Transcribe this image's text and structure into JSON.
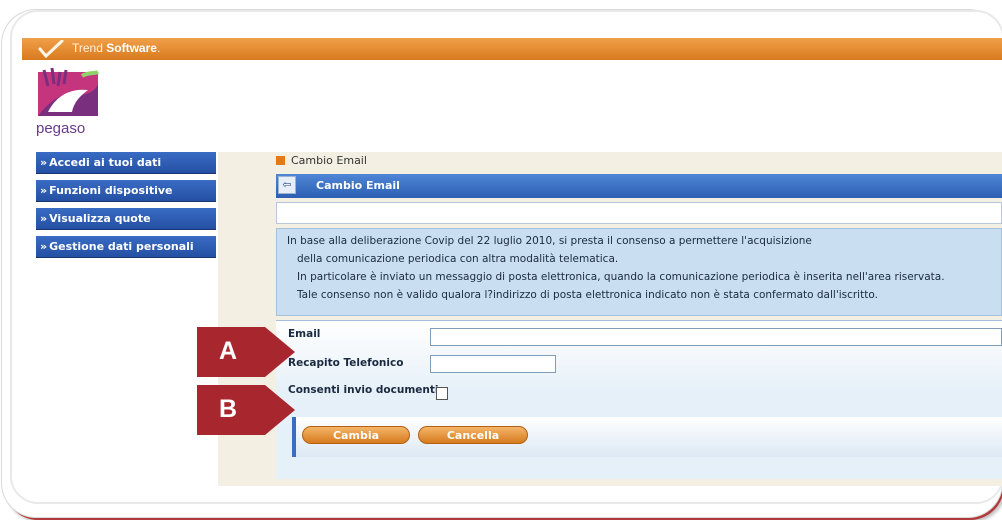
{
  "app": {
    "vendor_prefix": "Trend ",
    "vendor_name": "Software",
    "logo_text": "pegaso"
  },
  "sidebar": {
    "items": [
      {
        "label": "Accedi ai tuoi dati"
      },
      {
        "label": "Funzioni dispositive"
      },
      {
        "label": "Visualizza quote"
      },
      {
        "label": "Gestione dati personali"
      }
    ]
  },
  "main": {
    "breadcrumb": "Cambio Email",
    "title": "Cambio Email",
    "info_lines": [
      "In base alla deliberazione Covip del 22 luglio 2010, si presta il consenso a permettere l'acquisizione",
      "della comunicazione periodica con altra modalità telematica.",
      "In particolare è inviato un messaggio di posta elettronica, quando la comunicazione periodica è inserita nell'area riservata.",
      "Tale consenso non è valido qualora l?indirizzo di posta elettronica indicato non è stata confermato dall'iscritto."
    ]
  },
  "form": {
    "email_label": "Email",
    "email_value": "",
    "phone_label": "Recapito Telefonico",
    "phone_value": "",
    "consent_label": "Consenti invio documenti",
    "consent_checked": false,
    "submit_label": "Cambia",
    "cancel_label": "Cancella"
  },
  "callouts": {
    "a": "A",
    "b": "B"
  },
  "colors": {
    "topbar": "#d97a1e",
    "nav": "#2450a3",
    "callout": "#a8272f",
    "button": "#e08a2c"
  },
  "icons": {
    "brand": "trend-software-check-icon",
    "crumb": "module-icon",
    "title_toggle": "collapse-icon"
  }
}
